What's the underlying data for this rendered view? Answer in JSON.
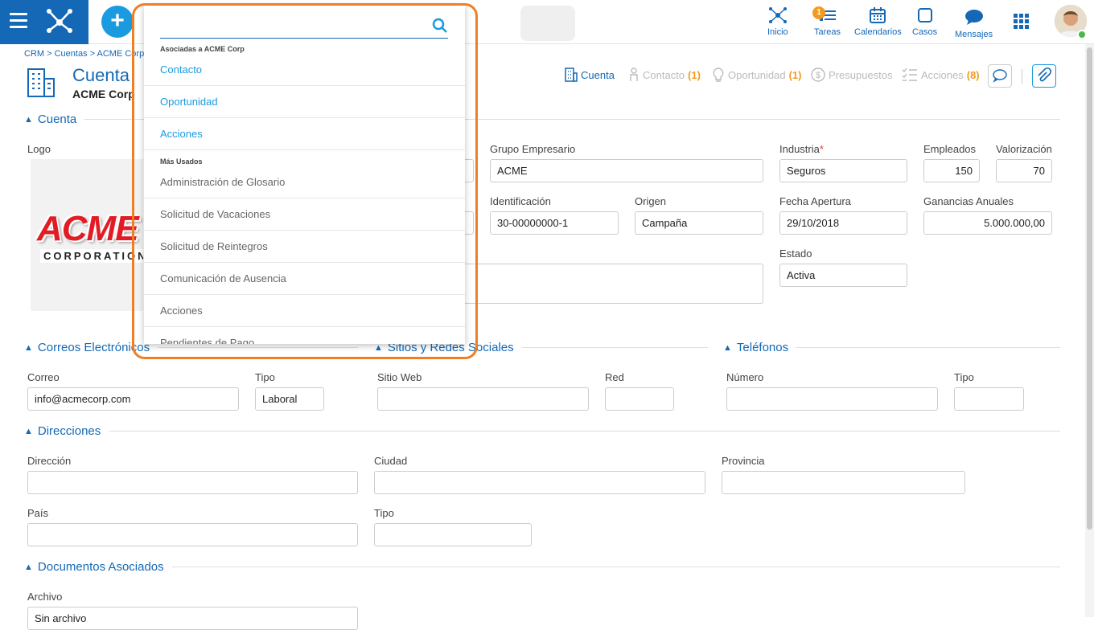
{
  "topnav": {
    "items": [
      {
        "label": "Inicio",
        "icon": "hub-icon"
      },
      {
        "label": "Tareas",
        "icon": "tasks-icon",
        "badge": "1"
      },
      {
        "label": "Calendarios",
        "icon": "calendar-icon"
      },
      {
        "label": "Casos",
        "icon": "cases-icon"
      },
      {
        "label": "Mensajes",
        "icon": "chat-icon"
      }
    ]
  },
  "breadcrumb": [
    "CRM",
    "Cuentas",
    "ACME Corp"
  ],
  "page": {
    "title": "Cuenta",
    "subtitle": "ACME Corp"
  },
  "related_tabs": [
    {
      "label": "Cuenta",
      "count": ""
    },
    {
      "label": "Contacto",
      "count": "(1)"
    },
    {
      "label": "Oportunidad",
      "count": "(1)"
    },
    {
      "label": "Presupuestos",
      "count": ""
    },
    {
      "label": "Acciones",
      "count": "(8)"
    }
  ],
  "sections": {
    "cuenta": "Cuenta",
    "correos": "Correos Electrónicos",
    "sitios": "Sitios y Redes Sociales",
    "telefonos": "Teléfonos",
    "direcciones": "Direcciones",
    "documentos": "Documentos Asociados"
  },
  "account": {
    "logo_label": "Logo",
    "logo_text": "ACME",
    "logo_sub": "CORPORATION",
    "grupo_label": "Grupo Empresario",
    "grupo_value": "ACME",
    "industria_label": "Industria",
    "industria_req": "*",
    "industria_value": "Seguros",
    "empleados_label": "Empleados",
    "empleados_value": "150",
    "valorizacion_label": "Valorización",
    "valorizacion_value": "70",
    "identificacion_label": "Identificación",
    "identificacion_value": "30-00000000-1",
    "origen_label": "Origen",
    "origen_value": "Campaña",
    "fecha_label": "Fecha Apertura",
    "fecha_value": "29/10/2018",
    "ganancias_label": "Ganancias Anuales",
    "ganancias_value": "5.000.000,00",
    "estado_label": "Estado",
    "estado_value": "Activa"
  },
  "emails": {
    "correo_label": "Correo",
    "correo_value": "info@acmecorp.com",
    "tipo_label": "Tipo",
    "tipo_value": "Laboral"
  },
  "sites": {
    "sitio_label": "Sitio Web",
    "red_label": "Red"
  },
  "phones": {
    "numero_label": "Número",
    "tipo_label": "Tipo"
  },
  "address": {
    "direccion_label": "Dirección",
    "ciudad_label": "Ciudad",
    "provincia_label": "Provincia",
    "pais_label": "País",
    "tipo_label": "Tipo"
  },
  "documents": {
    "archivo_label": "Archivo",
    "archivo_value": "Sin archivo"
  },
  "dropdown": {
    "search_value": "",
    "group1_title": "Asociadas a ACME Corp",
    "group1_items": [
      "Contacto",
      "Oportunidad",
      "Acciones"
    ],
    "group2_title": "Más Usados",
    "group2_items": [
      "Administración de Glosario",
      "Solicitud de Vacaciones",
      "Solicitud de Reintegros",
      "Comunicación de Ausencia",
      "Acciones",
      "Pendientes de Pago"
    ]
  },
  "colors": {
    "brand": "#1468b5",
    "accent": "#1a9be0",
    "highlight": "#f07e25",
    "count": "#f39a1e"
  }
}
